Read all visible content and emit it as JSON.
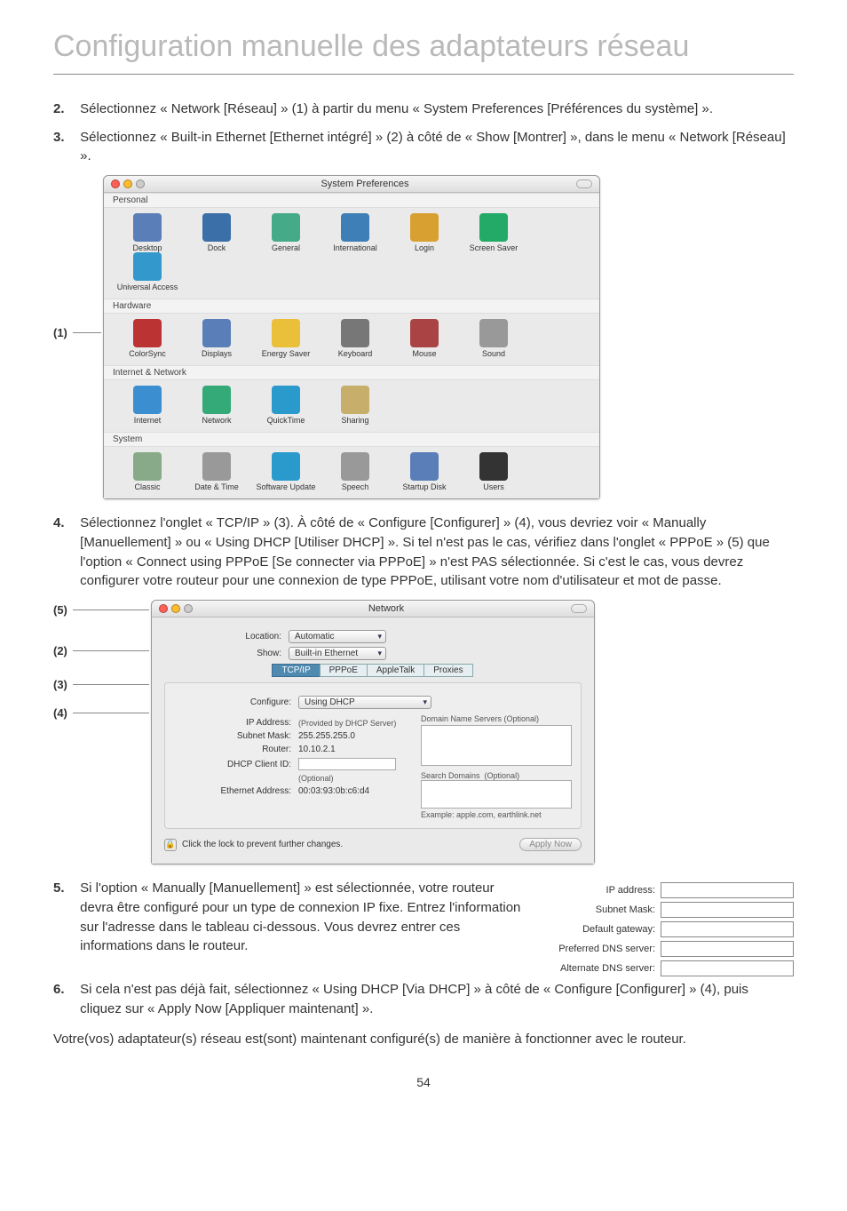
{
  "page": {
    "title": "Configuration manuelle des adaptateurs réseau",
    "number": "54"
  },
  "steps": {
    "s2": {
      "num": "2.",
      "text": "Sélectionnez « Network [Réseau] » (1) à partir du menu « System Preferences [Préférences du système] »."
    },
    "s3": {
      "num": "3.",
      "text": "Sélectionnez « Built-in Ethernet [Ethernet intégré] » (2) à côté de « Show [Montrer] », dans le menu « Network [Réseau] »."
    },
    "s4": {
      "num": "4.",
      "text": "Sélectionnez l'onglet « TCP/IP » (3). À côté de « Configure [Configurer] » (4), vous devriez voir « Manually [Manuellement] » ou « Using DHCP [Utiliser DHCP] ». Si tel n'est pas le cas, vérifiez dans l'onglet « PPPoE » (5) que l'option « Connect using PPPoE [Se connecter via PPPoE] » n'est PAS sélectionnée. Si c'est le cas, vous devrez configurer votre routeur pour une connexion de type PPPoE, utilisant votre nom d'utilisateur et mot de passe."
    },
    "s5": {
      "num": "5.",
      "text": "Si l'option « Manually [Manuellement] » est sélectionnée, votre routeur devra être configuré pour un type de connexion IP fixe. Entrez l'information sur l'adresse dans le tableau ci-dessous. Vous devrez entrer ces informations dans le routeur."
    },
    "s6": {
      "num": "6.",
      "text": "Si cela n'est pas déjà fait, sélectionnez « Using DHCP [Via DHCP] » à côté de « Configure [Configurer] » (4), puis cliquez sur « Apply Now [Appliquer maintenant] »."
    }
  },
  "closing": "Votre(vos) adaptateur(s) réseau est(sont) maintenant configuré(s) de manière à fonctionner avec le routeur.",
  "callouts": {
    "c1": "(1)",
    "c2": "(2)",
    "c3": "(3)",
    "c4": "(4)",
    "c5": "(5)"
  },
  "sysprefs": {
    "windowTitle": "System Preferences",
    "sections": {
      "personal": {
        "label": "Personal",
        "items": [
          "Desktop",
          "Dock",
          "General",
          "International",
          "Login",
          "Screen Saver",
          "Universal Access"
        ]
      },
      "hardware": {
        "label": "Hardware",
        "items": [
          "ColorSync",
          "Displays",
          "Energy Saver",
          "Keyboard",
          "Mouse",
          "Sound"
        ]
      },
      "internet": {
        "label": "Internet & Network",
        "items": [
          "Internet",
          "Network",
          "QuickTime",
          "Sharing"
        ]
      },
      "system": {
        "label": "System",
        "items": [
          "Classic",
          "Date & Time",
          "Software Update",
          "Speech",
          "Startup Disk",
          "Users"
        ]
      }
    }
  },
  "network": {
    "windowTitle": "Network",
    "locationLabel": "Location:",
    "locationValue": "Automatic",
    "showLabel": "Show:",
    "showValue": "Built-in Ethernet",
    "tabs": [
      "TCP/IP",
      "PPPoE",
      "AppleTalk",
      "Proxies"
    ],
    "configureLabel": "Configure:",
    "configureValue": "Using DHCP",
    "dnsLabel": "Domain Name Servers (Optional)",
    "ipAddressLabel": "IP Address:",
    "ipAddressNote": "(Provided by DHCP Server)",
    "subnetLabel": "Subnet Mask:",
    "subnetValue": "255.255.255.0",
    "routerLabel": "Router:",
    "routerValue": "10.10.2.1",
    "searchDomainsLabel": "Search Domains",
    "searchDomainsOpt": "(Optional)",
    "dhcpClientLabel": "DHCP Client ID:",
    "dhcpClientNote": "(Optional)",
    "etherLabel": "Ethernet Address:",
    "etherValue": "00:03:93:0b:c6:d4",
    "exampleNote": "Example: apple.com, earthlink.net",
    "lockText": "Click the lock to prevent further changes.",
    "applyBtn": "Apply Now"
  },
  "ipTable": {
    "rows": [
      {
        "k": "IP address:"
      },
      {
        "k": "Subnet Mask:"
      },
      {
        "k": "Default gateway:"
      },
      {
        "k": "Preferred DNS server:"
      },
      {
        "k": "Alternate DNS server:"
      }
    ]
  },
  "iconColors": {
    "personal": [
      "#5a7fb8",
      "#3b6fa8",
      "#4a8",
      "#3f7fb8",
      "#d8a030",
      "#2a6",
      "#39c"
    ],
    "hardware": [
      "#b33",
      "#5a7fb8",
      "#eabf3a",
      "#777",
      "#a44",
      "#999"
    ],
    "internet": [
      "#3b8fd0",
      "#3a7",
      "#2a99cc",
      "#c7ae6a"
    ],
    "system": [
      "#8a8",
      "#999",
      "#2a99cc",
      "#999",
      "#5a7fb8",
      "#333"
    ]
  }
}
